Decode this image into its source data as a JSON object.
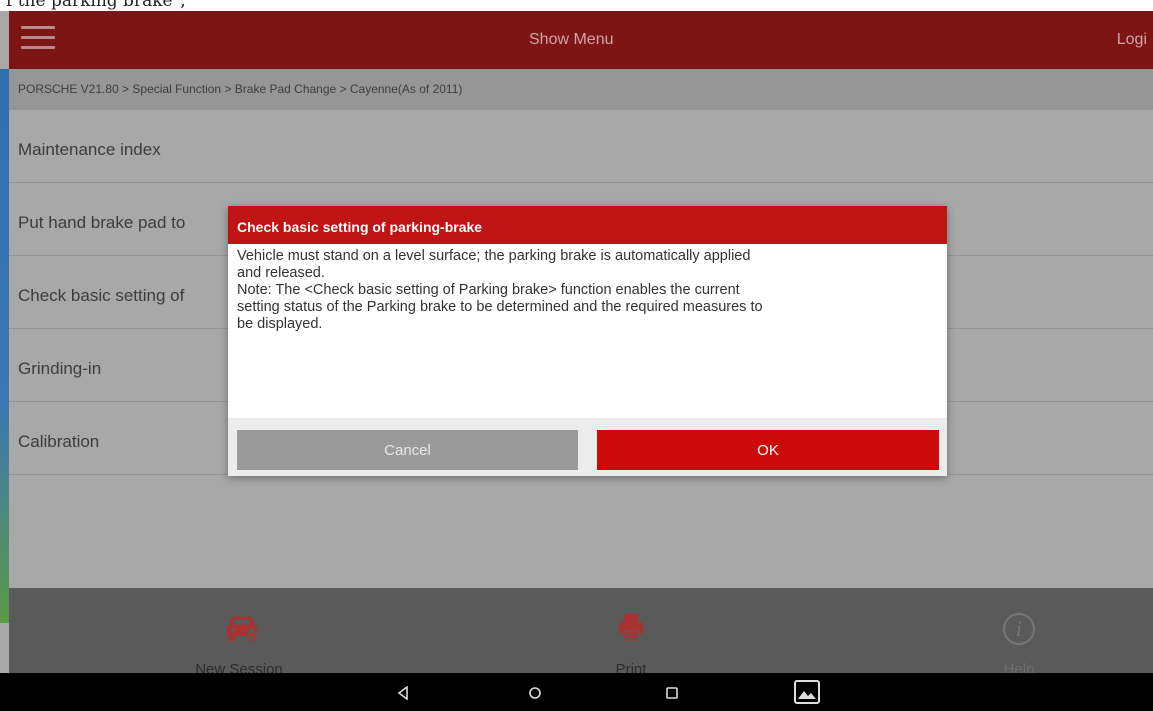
{
  "doc_strip": {
    "text": "f the parking brake\","
  },
  "topbar": {
    "title": "Show Menu",
    "login": "Logi"
  },
  "breadcrumb": "PORSCHE V21.80 > Special Function > Brake Pad Change > Cayenne(As of 2011)",
  "menu_items": [
    {
      "label": "Maintenance index"
    },
    {
      "label": "Put hand brake pad to"
    },
    {
      "label": "Check basic setting of"
    },
    {
      "label": "Grinding-in"
    },
    {
      "label": "Calibration"
    }
  ],
  "dialog": {
    "title": "Check basic setting of parking-brake",
    "body": "Vehicle must stand on a level surface; the parking brake is automatically applied\nand released.\nNote: The <Check basic setting of Parking brake> function enables the current\nsetting status of the Parking brake to be determined and the required measures to\nbe displayed.",
    "cancel_label": "Cancel",
    "ok_label": "OK"
  },
  "bottom_nav": [
    {
      "label": "New Session",
      "icon": "car-icon"
    },
    {
      "label": "Print",
      "icon": "printer-icon"
    },
    {
      "label": "Help",
      "icon": "info-icon"
    }
  ],
  "system_bar": {
    "icons": [
      "back-icon",
      "home-icon",
      "recents-icon",
      "gallery-icon"
    ]
  },
  "colors": {
    "header": "#7d1515",
    "dialog_header": "#c01313",
    "ok_button": "#cc0a0a",
    "cancel_button": "#9a9a9a",
    "icon_red": "#a83232"
  }
}
